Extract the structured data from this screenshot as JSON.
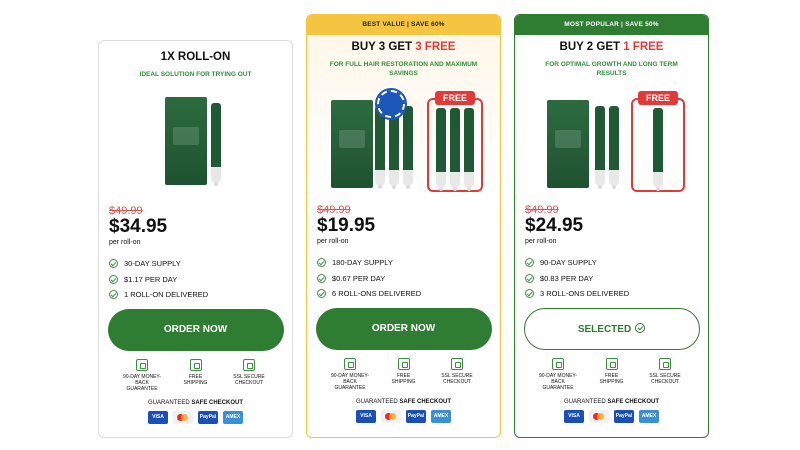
{
  "cards": [
    {
      "ribbon": "",
      "title_prefix": "1X ROLL-ON",
      "title_free": "",
      "subtitle": "IDEAL SOLUTION FOR TRYING OUT",
      "old_price": "$49.99",
      "price": "$34.95",
      "per": "per roll-on",
      "features": [
        "30-DAY SUPPLY",
        "$1.17 PER DAY",
        "1 ROLL-ON DELIVERED"
      ],
      "cta": "ORDER NOW"
    },
    {
      "ribbon": "BEST VALUE | SAVE 60%",
      "title_prefix": "BUY 3 GET ",
      "title_free": "3 FREE",
      "subtitle": "FOR FULL HAIR RESTORATION AND MAXIMUM SAVINGS",
      "old_price": "$49.99",
      "price": "$19.95",
      "per": "per roll-on",
      "features": [
        "180-DAY SUPPLY",
        "$0.67 PER DAY",
        "6 ROLL-ONS DELIVERED"
      ],
      "cta": "ORDER NOW",
      "free_tag": "FREE"
    },
    {
      "ribbon": "MOST POPULAR | SAVE 50%",
      "title_prefix": "BUY 2 GET ",
      "title_free": "1 FREE",
      "subtitle": "FOR OPTIMAL GROWTH AND LONG TERM RESULTS",
      "old_price": "$49.99",
      "price": "$24.95",
      "per": "per roll-on",
      "features": [
        "90-DAY SUPPLY",
        "$0.83 PER DAY",
        "3 ROLL-ONS DELIVERED"
      ],
      "cta": "SELECTED",
      "free_tag": "FREE"
    }
  ],
  "badges": [
    {
      "line1": "90-DAY MONEY-BACK",
      "line2": "GUARANTEE",
      "icon": "money-back-icon"
    },
    {
      "line1": "FREE",
      "line2": "SHIPPING",
      "icon": "truck-icon"
    },
    {
      "line1": "SSL SECURE",
      "line2": "CHECKOUT",
      "icon": "lock-icon"
    }
  ],
  "secure_prefix": "GUARANTEED",
  "secure_bold": "SAFE CHECKOUT",
  "payments": [
    "VISA",
    "",
    "PayPal",
    "AMEX"
  ],
  "colors": {
    "green": "#2f7d32",
    "gold": "#f5c542",
    "red": "#e03a3a"
  }
}
